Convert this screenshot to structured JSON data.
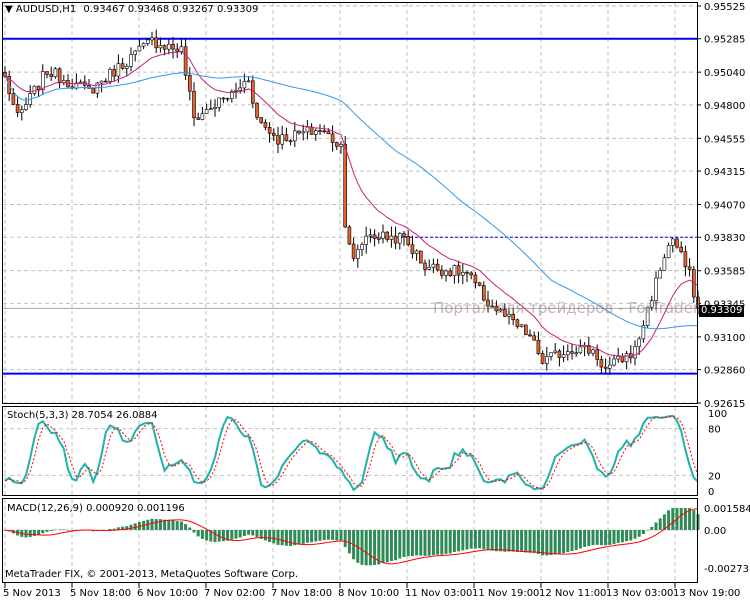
{
  "header": {
    "symbol_label": "AUDUSD,H1",
    "ohlc": "0.93467 0.93468 0.93267 0.93309"
  },
  "watermark": "Портал для трейдеров - ForTrader.ru",
  "current_price_label": "0.93309",
  "footer": "MetaTrader FIX, © 2001-2013, MetaQuotes Software Corp.",
  "colors": {
    "bull": "#ffffff",
    "bear": "#e8602c",
    "ma_fast": "#cc1f7a",
    "ma_slow": "#3399ee",
    "level": "#0000ff",
    "stoch_main": "#20b2aa",
    "stoch_signal": "#ff0000",
    "macd_hist": "#2e8b57",
    "macd_signal": "#ff0000"
  },
  "chart_data": [
    {
      "type": "candlestick",
      "title": "AUDUSD,H1",
      "y_ticks": [
        "0.95525",
        "0.95285",
        "0.95040",
        "0.94800",
        "0.94555",
        "0.94315",
        "0.94070",
        "0.93830",
        "0.93585",
        "0.93345",
        "0.93100",
        "0.92860",
        "0.92615"
      ],
      "ylim": [
        0.92615,
        0.95525
      ],
      "x_ticks": [
        "5 Nov 2013",
        "5 Nov 18:00",
        "6 Nov 10:00",
        "7 Nov 02:00",
        "7 Nov 18:00",
        "8 Nov 10:00",
        "11 Nov 03:00",
        "11 Nov 19:00",
        "12 Nov 11:00",
        "13 Nov 03:00",
        "13 Nov 19:00"
      ],
      "close_waypoints": [
        [
          0,
          0.95
        ],
        [
          3,
          0.947
        ],
        [
          10,
          0.9505
        ],
        [
          20,
          0.949
        ],
        [
          30,
          0.9515
        ],
        [
          35,
          0.9527
        ],
        [
          42,
          0.952
        ],
        [
          45,
          0.947
        ],
        [
          55,
          0.949
        ],
        [
          58,
          0.95
        ],
        [
          60,
          0.947
        ],
        [
          65,
          0.9455
        ],
        [
          75,
          0.9462
        ],
        [
          80,
          0.945
        ],
        [
          81,
          0.9395
        ],
        [
          83,
          0.9365
        ],
        [
          86,
          0.9385
        ],
        [
          95,
          0.9382
        ],
        [
          100,
          0.9362
        ],
        [
          110,
          0.9356
        ],
        [
          115,
          0.9335
        ],
        [
          125,
          0.931
        ],
        [
          128,
          0.9292
        ],
        [
          135,
          0.9302
        ],
        [
          140,
          0.93
        ],
        [
          143,
          0.9286
        ],
        [
          150,
          0.93
        ],
        [
          153,
          0.933
        ],
        [
          157,
          0.937
        ],
        [
          159,
          0.9382
        ],
        [
          163,
          0.9355
        ],
        [
          165,
          0.9331
        ]
      ],
      "levels": [
        0.95285,
        0.9283
      ],
      "dotted_level": 0.9383,
      "indicators": [
        "EMA",
        "SMA"
      ]
    },
    {
      "type": "line",
      "title": "Stoch(5,3,3) 28.7054 26.0884",
      "y_ticks": [
        "100",
        "80",
        "20",
        "0"
      ],
      "ylim": [
        0,
        100
      ]
    },
    {
      "type": "bar",
      "title": "MACD(12,26,9) 0.000920 0.001196",
      "y_ticks": [
        "0.001584",
        "0.00",
        "-0.002731"
      ],
      "ylim": [
        -0.002731,
        0.001584
      ]
    }
  ]
}
